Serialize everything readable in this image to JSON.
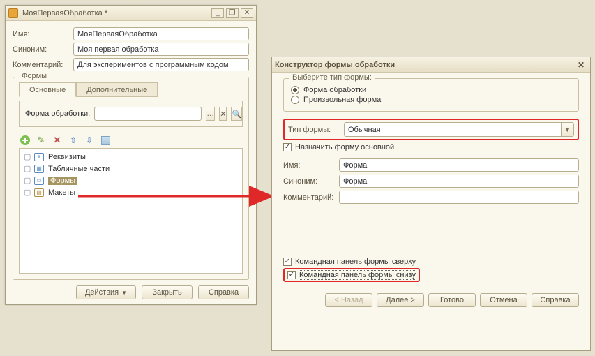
{
  "left": {
    "title": "МояПерваяОбработка *",
    "fields": {
      "name_label": "Имя:",
      "name_value": "МояПерваяОбработка",
      "synonym_label": "Синоним:",
      "synonym_value": "Моя первая обработка",
      "comment_label": "Комментарий:",
      "comment_value": "Для экспериментов с программным кодом"
    },
    "forms_group_label": "Формы",
    "tabs": {
      "main": "Основные",
      "extra": "Дополнительные"
    },
    "form_processing_label": "Форма обработки:",
    "form_processing_value": "",
    "tree": [
      {
        "label": "Реквизиты",
        "icon": "blue"
      },
      {
        "label": "Табличные части",
        "icon": "tbl"
      },
      {
        "label": "Формы",
        "icon": "form",
        "selected": true
      },
      {
        "label": "Макеты",
        "icon": "tmpl"
      }
    ],
    "buttons": {
      "actions": "Действия",
      "close": "Закрыть",
      "help": "Справка"
    }
  },
  "right": {
    "title": "Конструктор формы обработки",
    "choose_type_label": "Выберите тип формы:",
    "radios": {
      "processing": "Форма обработки",
      "arbitrary": "Произвольная форма"
    },
    "form_type_label": "Тип формы:",
    "form_type_value": "Обычная",
    "set_main_label": "Назначить форму основной",
    "name_label": "Имя:",
    "name_value": "Форма",
    "synonym_label": "Синоним:",
    "synonym_value": "Форма",
    "comment_label": "Комментарий:",
    "comment_value": "",
    "cmd_top": "Командная панель формы сверху",
    "cmd_bottom": "Командная панель формы снизу",
    "buttons": {
      "back": "< Назад",
      "next": "Далее >",
      "done": "Готово",
      "cancel": "Отмена",
      "help": "Справка"
    }
  }
}
